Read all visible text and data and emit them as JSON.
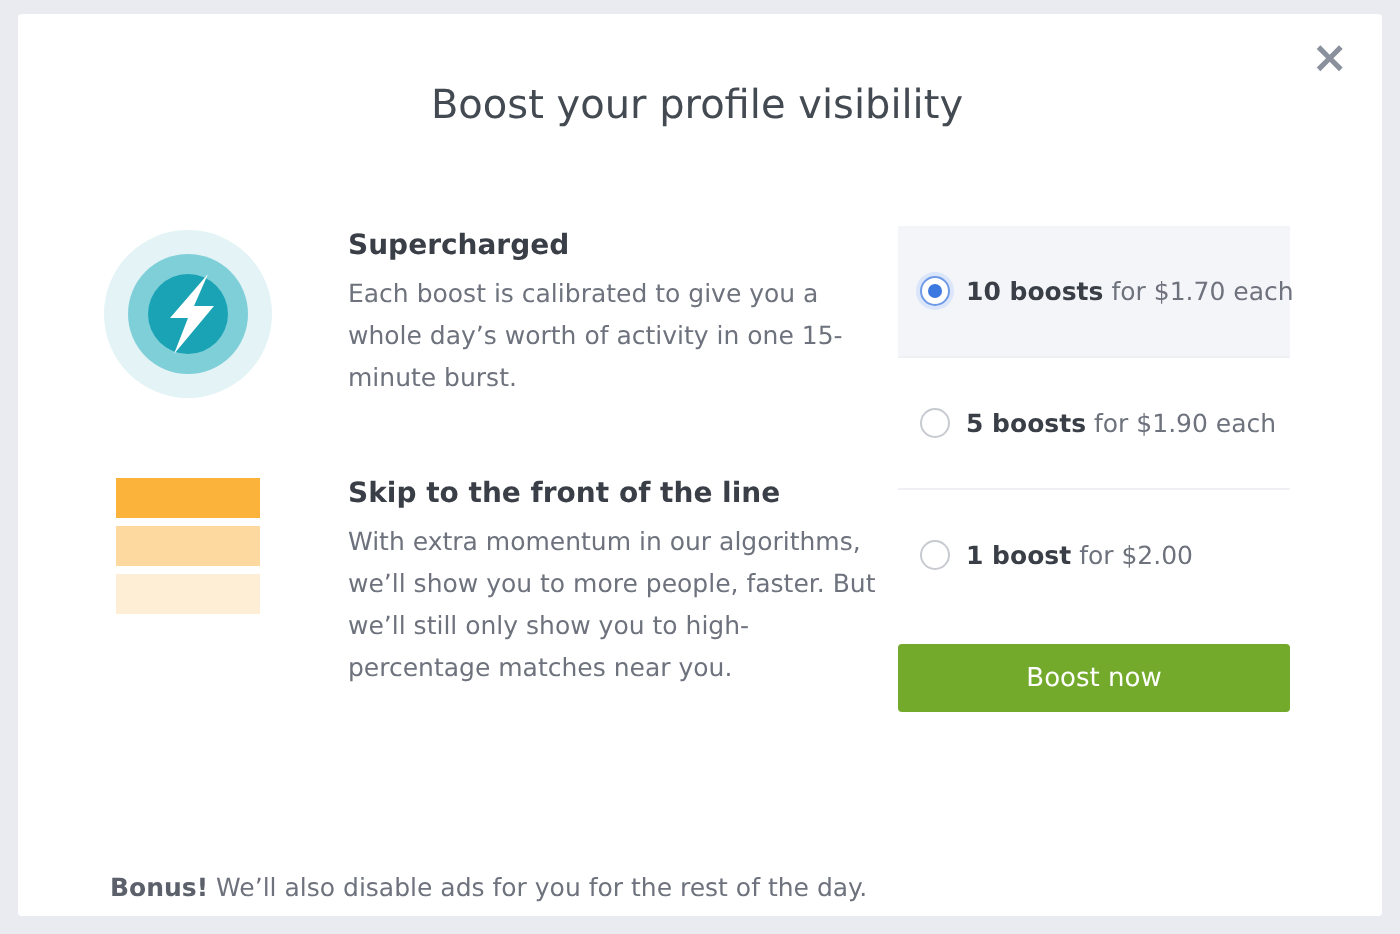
{
  "dialog": {
    "title": "Boost your profile visibility",
    "close": "×"
  },
  "features": [
    {
      "kind": "bolt",
      "title": "Supercharged",
      "text": "Each boost is calibrated to give you a whole day’s worth of activity in one 15-minute burst."
    },
    {
      "kind": "stack",
      "title": "Skip to the front of the line",
      "text": "With extra momentum in our algorithms, we’ll show you to more people, faster. But we’ll still only show you to high-percentage matches near you."
    }
  ],
  "options": [
    {
      "label": "**10 boosts** for $1.70 each",
      "selected": true
    },
    {
      "label": "**5 boosts** for $1.90 each",
      "selected": false
    },
    {
      "label": "**1 boost** for $2.00",
      "selected": false
    }
  ],
  "button": "Boost now",
  "bonus": "**Bonus!** We’ll also disable ads for you for the rest of the day."
}
